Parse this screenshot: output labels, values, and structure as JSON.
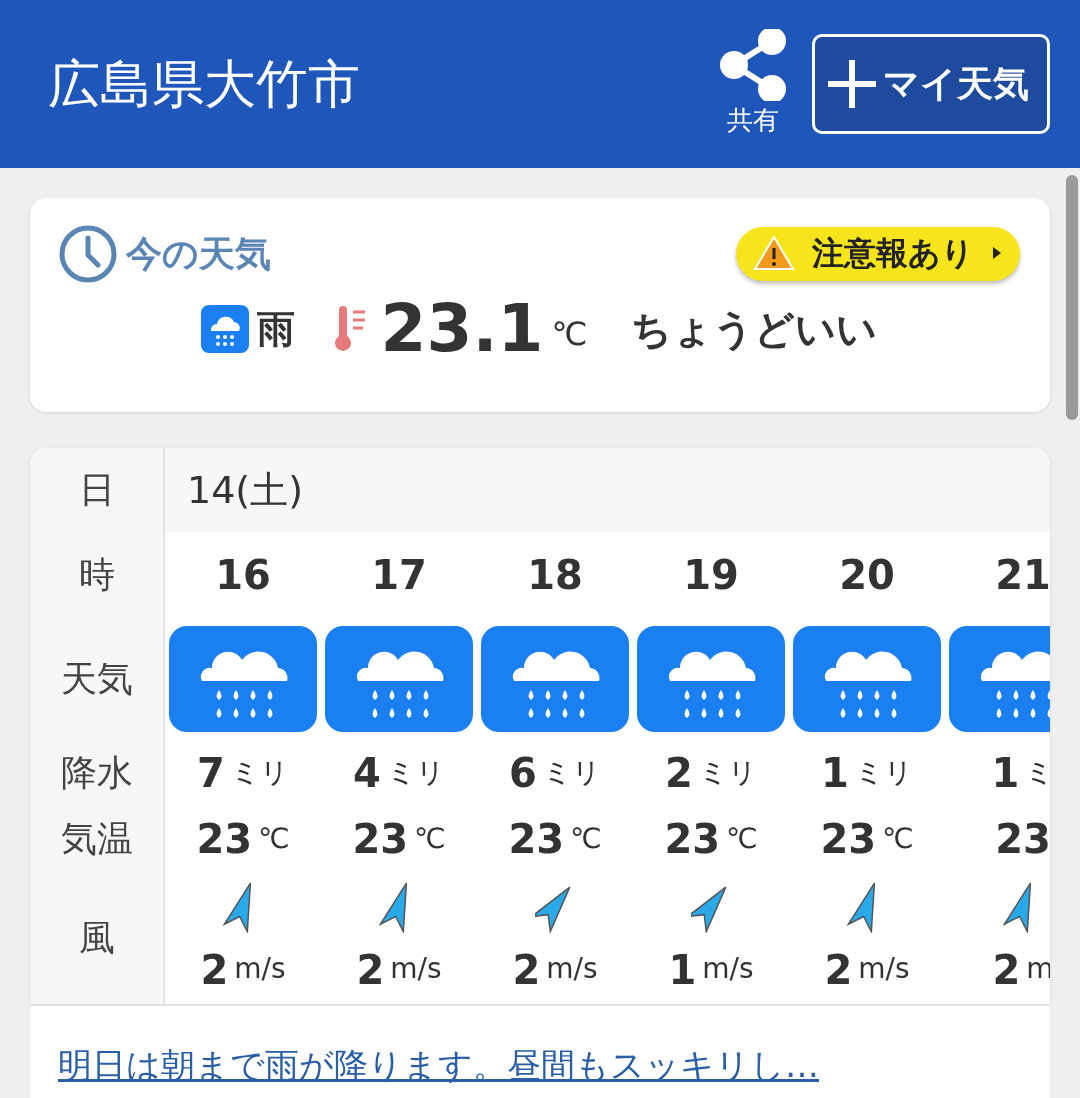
{
  "header": {
    "title": "広島県大竹市",
    "share_label": "共有",
    "my_weather_button": "マイ天気"
  },
  "now": {
    "heading": "今の天気",
    "alert": "注意報あり",
    "weather": "雨",
    "temperature": "23.1",
    "temp_unit": "℃",
    "feeling": "ちょうどいい"
  },
  "forecast": {
    "labels": {
      "day": "日",
      "hour": "時",
      "weather": "天気",
      "precip": "降水",
      "temp": "気温",
      "wind": "風"
    },
    "date": "14(土)",
    "hours": [
      {
        "hour": "16",
        "precip": "7",
        "precip_unit": "ミリ",
        "temp": "23",
        "temp_unit": "℃",
        "kind": "nne",
        "wind": "2",
        "wind_unit": "m/s"
      },
      {
        "hour": "17",
        "precip": "4",
        "precip_unit": "ミリ",
        "temp": "23",
        "temp_unit": "℃",
        "kind": "nne",
        "wind": "2",
        "wind_unit": "m/s"
      },
      {
        "hour": "18",
        "precip": "6",
        "precip_unit": "ミリ",
        "temp": "23",
        "temp_unit": "℃",
        "kind": "ne",
        "wind": "2",
        "wind_unit": "m/s"
      },
      {
        "hour": "19",
        "precip": "2",
        "precip_unit": "ミリ",
        "temp": "23",
        "temp_unit": "℃",
        "kind": "ne",
        "wind": "1",
        "wind_unit": "m/s"
      },
      {
        "hour": "20",
        "precip": "1",
        "precip_unit": "ミリ",
        "temp": "23",
        "temp_unit": "℃",
        "kind": "nne",
        "wind": "2",
        "wind_unit": "m/s"
      },
      {
        "hour": "21",
        "precip": "1",
        "precip_unit": "ミ",
        "temp": "23",
        "kind": "nne",
        "wind": "2",
        "wind_unit": "m"
      }
    ]
  },
  "summary_link": "明日は朝まで雨が降ります。昼間もスッキリし…"
}
